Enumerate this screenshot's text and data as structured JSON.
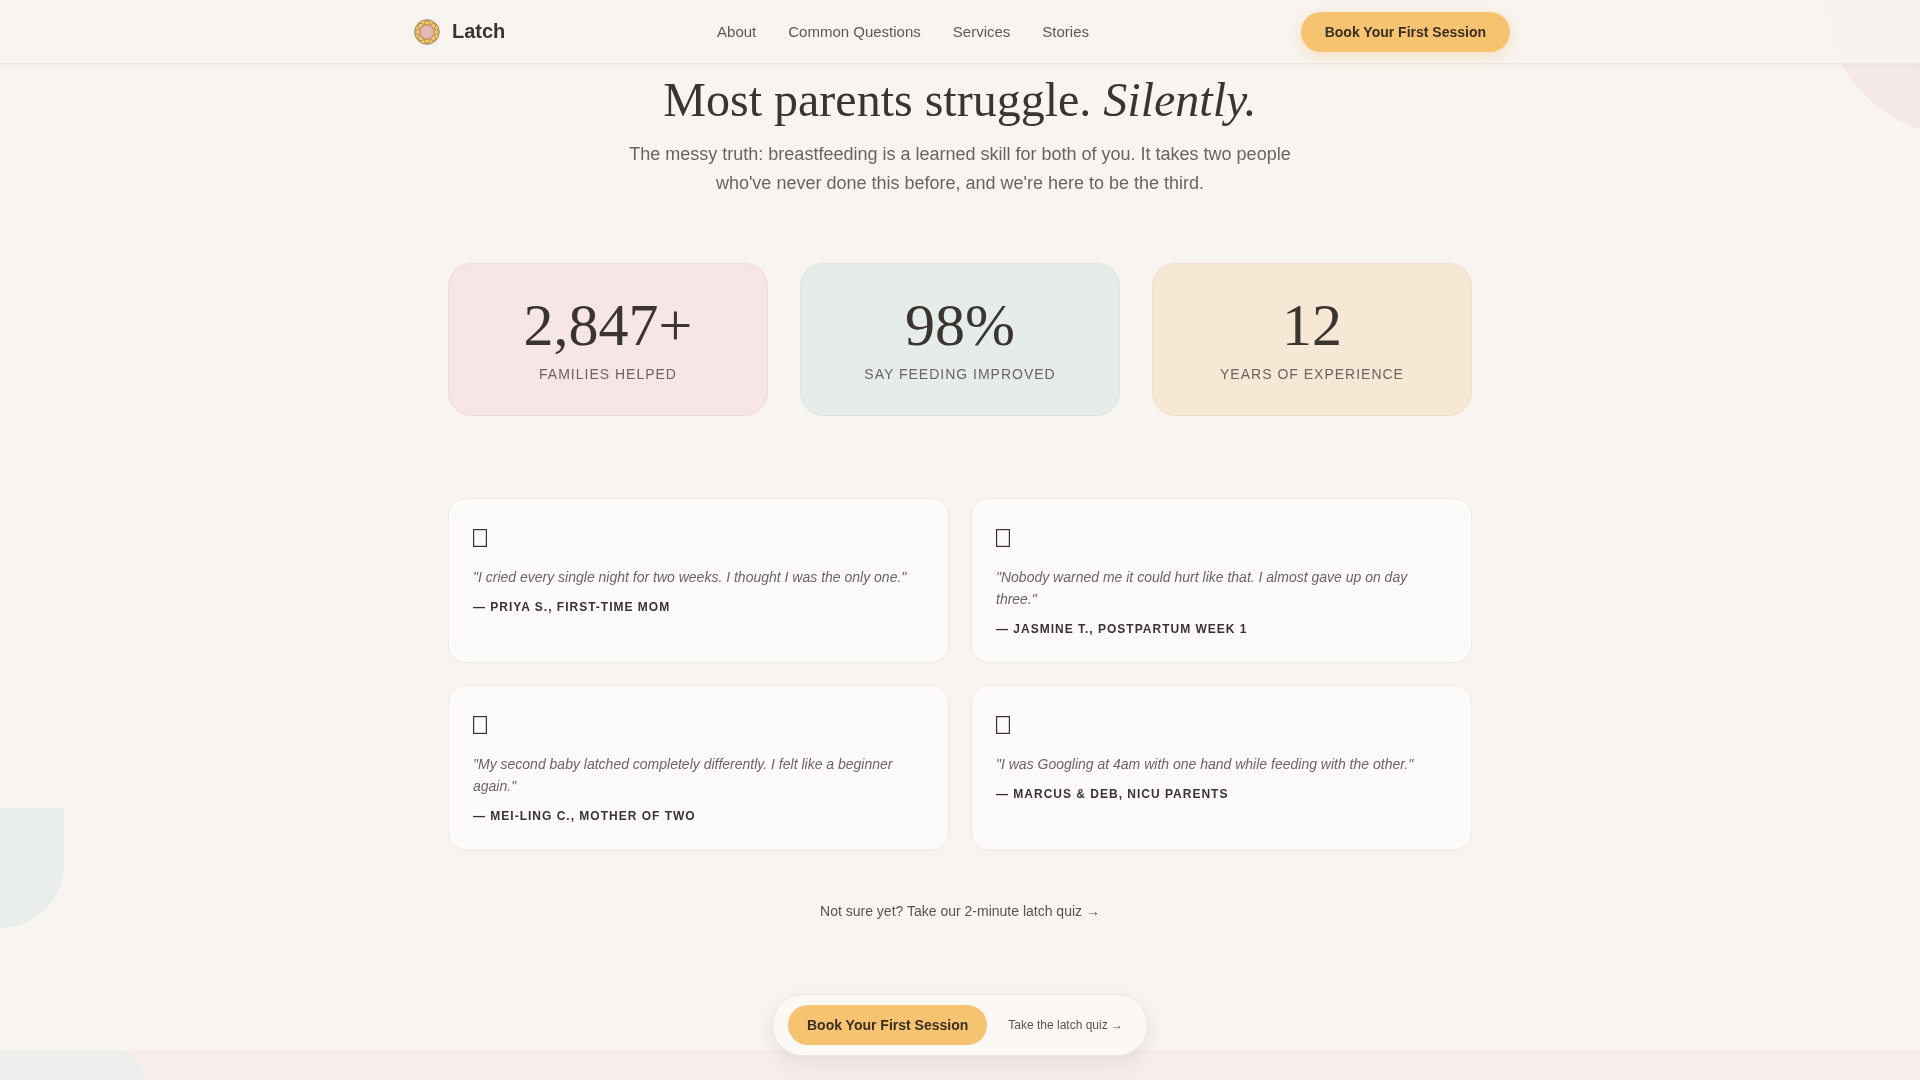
{
  "header": {
    "brand": "Latch",
    "nav": [
      "About",
      "Common Questions",
      "Services",
      "Stories"
    ],
    "cta": "Book Your First Session"
  },
  "hero": {
    "title": "Most parents struggle. *Silently.*",
    "subtitle": "The messy truth: breastfeeding is a learned skill for both of you. It takes two people who've never done this before, and we're here to be the third."
  },
  "stats": [
    {
      "value": "2,847+",
      "label": "FAMILIES HELPED",
      "color": "#f6e7e6"
    },
    {
      "value": "98%",
      "label": "SAY FEEDING IMPROVED",
      "color": "#e6ecea"
    },
    {
      "value": "12",
      "label": "YEARS OF EXPERIENCE",
      "color": "#f6e8d4"
    }
  ],
  "testimonials": [
    {
      "quote": "\"I cried every single night for two weeks. I thought I was the only one.\"",
      "author": "— PRIYA S., FIRST-TIME MOM"
    },
    {
      "quote": "\"Nobody warned me it could hurt like that. I almost gave up on day three.\"",
      "author": "— JASMINE T., POSTPARTUM WEEK 1"
    },
    {
      "quote": "\"My second baby latched completely differently. I felt like a beginner again.\"",
      "author": "— MEI-LING C., MOTHER OF TWO"
    },
    {
      "quote": "\"I was Googling at 4am with one hand while feeding with the other.\"",
      "author": "— MARCUS & DEB, NICU PARENTS"
    }
  ],
  "quiz_link": "Not sure yet? Take our 2-minute latch quiz →",
  "sticky_bar": {
    "button": "Book Your First Session",
    "link": "Take the latch quiz →"
  }
}
